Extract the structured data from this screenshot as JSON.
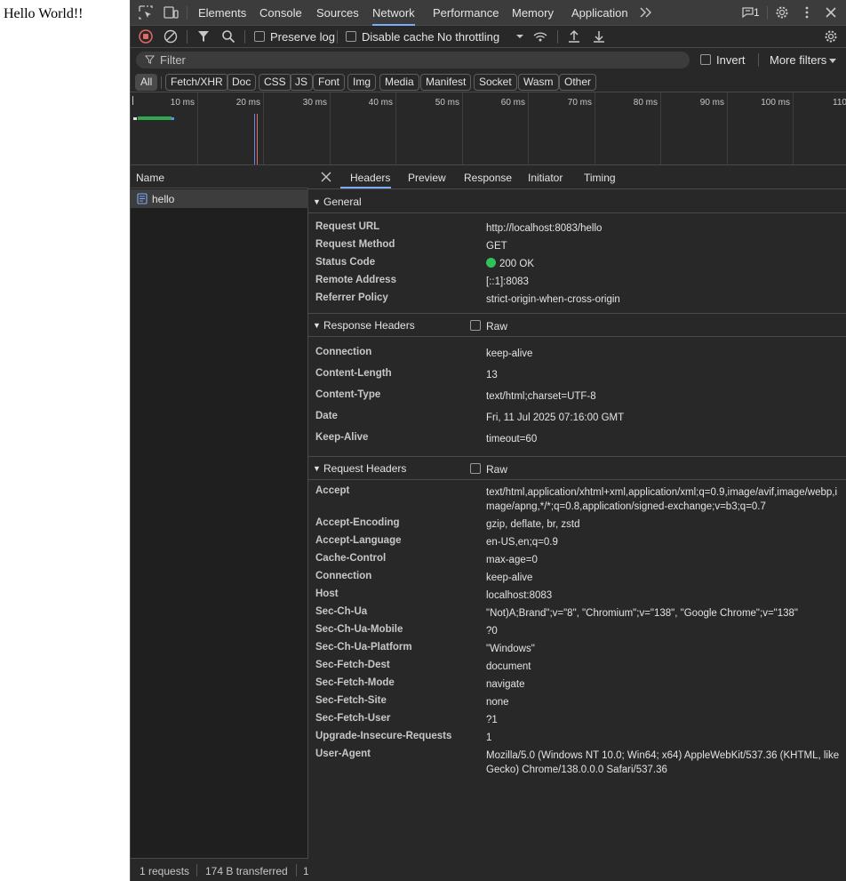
{
  "page": {
    "text": "Hello World!!"
  },
  "topbar": {
    "tabs": [
      {
        "label": "Elements"
      },
      {
        "label": "Console"
      },
      {
        "label": "Sources"
      },
      {
        "label": "Network"
      },
      {
        "label": "Performance"
      },
      {
        "label": "Memory"
      },
      {
        "label": "Application"
      }
    ],
    "issues_count": "1"
  },
  "toolbar": {
    "preserve_log": "Preserve log",
    "disable_cache": "Disable cache",
    "throttling": "No throttling"
  },
  "filter": {
    "placeholder": "Filter",
    "invert": "Invert",
    "more_filters": "More filters"
  },
  "type_filters": [
    "All",
    "Fetch/XHR",
    "Doc",
    "CSS",
    "JS",
    "Font",
    "Img",
    "Media",
    "Manifest",
    "Socket",
    "Wasm",
    "Other"
  ],
  "timeline": {
    "ticks": [
      "10 ms",
      "20 ms",
      "30 ms",
      "40 ms",
      "50 ms",
      "60 ms",
      "70 ms",
      "80 ms",
      "90 ms",
      "100 ms",
      "110"
    ]
  },
  "request_list": {
    "column_name": "Name",
    "rows": [
      {
        "name": "hello"
      }
    ]
  },
  "statusbar": {
    "requests": "1 requests",
    "transferred": "174 B transferred",
    "more": "1"
  },
  "details": {
    "tabs": [
      "Headers",
      "Preview",
      "Response",
      "Initiator",
      "Timing"
    ],
    "general": {
      "title": "General",
      "rows": [
        {
          "key": "Request URL",
          "value": "http://localhost:8083/hello"
        },
        {
          "key": "Request Method",
          "value": "GET"
        },
        {
          "key": "Status Code",
          "value": "200 OK"
        },
        {
          "key": "Remote Address",
          "value": "[::1]:8083"
        },
        {
          "key": "Referrer Policy",
          "value": "strict-origin-when-cross-origin"
        }
      ]
    },
    "response_headers": {
      "title": "Response Headers",
      "raw_label": "Raw",
      "rows": [
        {
          "key": "Connection",
          "value": "keep-alive"
        },
        {
          "key": "Content-Length",
          "value": "13"
        },
        {
          "key": "Content-Type",
          "value": "text/html;charset=UTF-8"
        },
        {
          "key": "Date",
          "value": "Fri, 11 Jul 2025 07:16:00 GMT"
        },
        {
          "key": "Keep-Alive",
          "value": "timeout=60"
        }
      ]
    },
    "request_headers": {
      "title": "Request Headers",
      "raw_label": "Raw",
      "rows": [
        {
          "key": "Accept",
          "value": "text/html,application/xhtml+xml,application/xml;q=0.9,image/avif,image/webp,image/apng,*/*;q=0.8,application/signed-exchange;v=b3;q=0.7"
        },
        {
          "key": "Accept-Encoding",
          "value": "gzip, deflate, br, zstd"
        },
        {
          "key": "Accept-Language",
          "value": "en-US,en;q=0.9"
        },
        {
          "key": "Cache-Control",
          "value": "max-age=0"
        },
        {
          "key": "Connection",
          "value": "keep-alive"
        },
        {
          "key": "Host",
          "value": "localhost:8083"
        },
        {
          "key": "Sec-Ch-Ua",
          "value": "\"Not)A;Brand\";v=\"8\", \"Chromium\";v=\"138\", \"Google Chrome\";v=\"138\""
        },
        {
          "key": "Sec-Ch-Ua-Mobile",
          "value": "?0"
        },
        {
          "key": "Sec-Ch-Ua-Platform",
          "value": "\"Windows\""
        },
        {
          "key": "Sec-Fetch-Dest",
          "value": "document"
        },
        {
          "key": "Sec-Fetch-Mode",
          "value": "navigate"
        },
        {
          "key": "Sec-Fetch-Site",
          "value": "none"
        },
        {
          "key": "Sec-Fetch-User",
          "value": "?1"
        },
        {
          "key": "Upgrade-Insecure-Requests",
          "value": "1"
        },
        {
          "key": "User-Agent",
          "value": "Mozilla/5.0 (Windows NT 10.0; Win64; x64) AppleWebKit/537.36 (KHTML, like Gecko) Chrome/138.0.0.0 Safari/537.36"
        }
      ]
    }
  },
  "colors": {
    "accent": "#7cacf8",
    "status_ok": "#2fc25b",
    "record_stop": "#e46962"
  }
}
